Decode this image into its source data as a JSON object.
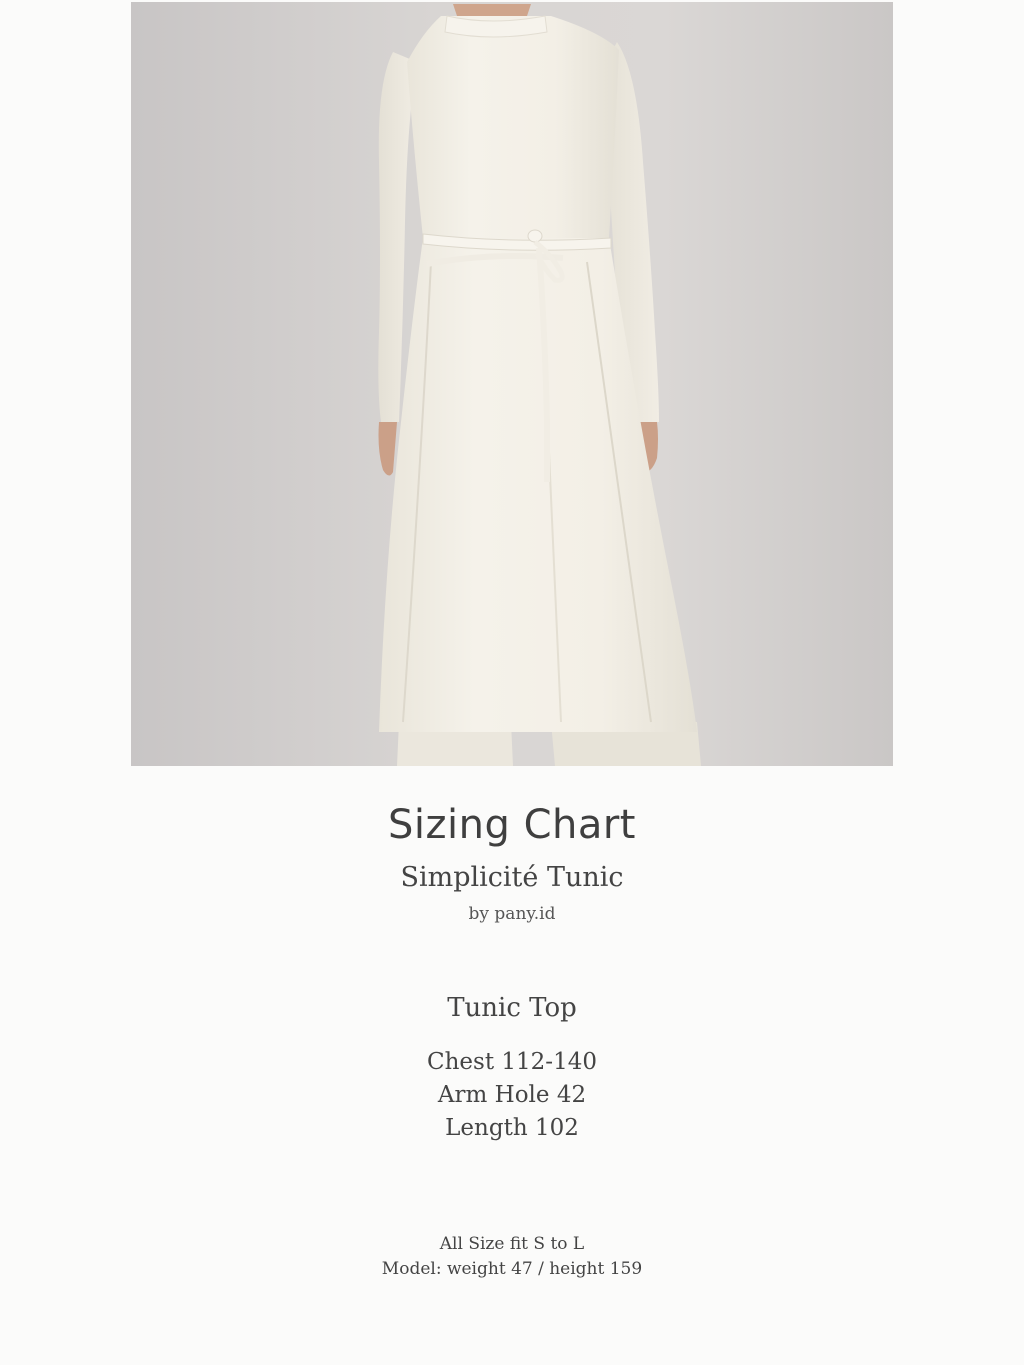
{
  "photo": {
    "icon": "product-photo-white-tunic",
    "colors": {
      "wall": "#d6d3d2",
      "garment": "#f3efe6",
      "skin": "#cfa58c"
    }
  },
  "header": {
    "title": "Sizing Chart",
    "product_name": "Simplicité Tunic",
    "brand": "by pany.id"
  },
  "section": {
    "heading": "Tunic Top",
    "measurements": [
      "Chest 112-140",
      "Arm Hole 42",
      "Length 102"
    ]
  },
  "footer": {
    "fit_note": "All Size fit S to L",
    "model_note": "Model: weight 47 / height 159"
  }
}
